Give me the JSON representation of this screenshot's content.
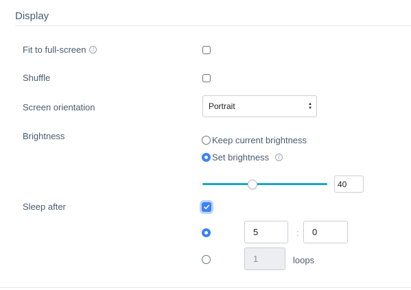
{
  "section": {
    "title": "Display"
  },
  "fit_to_fullscreen": {
    "label": "Fit to full-screen",
    "checked": false,
    "info_icon": "info-icon"
  },
  "shuffle": {
    "label": "Shuffle",
    "checked": false
  },
  "orientation": {
    "label": "Screen orientation",
    "value": "Portrait"
  },
  "brightness": {
    "label": "Brightness",
    "keep_label": "Keep current brightness",
    "set_label": "Set brightness",
    "selected": "set",
    "value": "40",
    "slider_percent": 40
  },
  "sleep": {
    "label": "Sleep after",
    "enabled": true,
    "time_hours": "5",
    "time_separator": ":",
    "time_minutes": "0",
    "loops_value": "1",
    "loops_label": "loops",
    "mode_selected": "time"
  },
  "colors": {
    "accent": "#3b82f6",
    "slider": "#1aa7c5",
    "label": "#4a5b6f"
  }
}
